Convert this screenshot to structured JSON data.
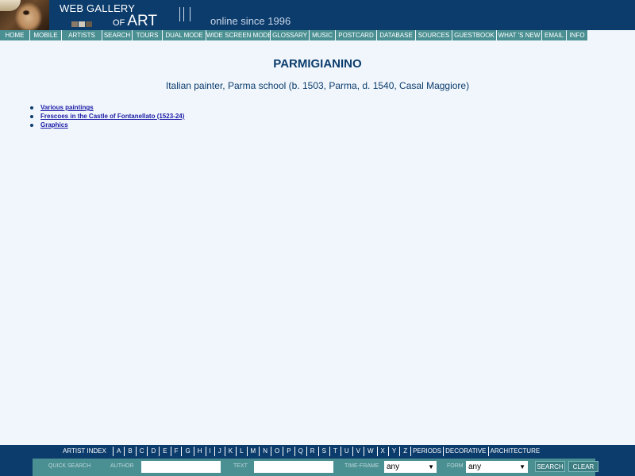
{
  "header": {
    "logo_line1": "WEB GALLERY",
    "logo_of": "OF",
    "logo_art": "ART",
    "tagline": "online since 1996",
    "logo_square_colors": [
      "#8a7a66",
      "#d0c8b8",
      "#6a5a48",
      "#a09888"
    ]
  },
  "nav": {
    "items": [
      {
        "label": "HOME"
      },
      {
        "label": "MOBILE"
      },
      {
        "label": "ARTISTS"
      },
      {
        "label": "SEARCH"
      },
      {
        "label": "TOURS"
      },
      {
        "label": "DUAL MODE"
      },
      {
        "label": "WIDE SCREEN MODES"
      },
      {
        "label": "GLOSSARY"
      },
      {
        "label": "MUSIC"
      },
      {
        "label": "POSTCARD"
      },
      {
        "label": "DATABASE"
      },
      {
        "label": "SOURCES"
      },
      {
        "label": "GUESTBOOK"
      },
      {
        "label": "WHAT 'S NEW"
      },
      {
        "label": "EMAIL"
      },
      {
        "label": "INFO"
      }
    ]
  },
  "content": {
    "title": "PARMIGIANINO",
    "subtitle": "Italian painter, Parma school (b. 1503, Parma, d. 1540, Casal Maggiore)",
    "links": [
      {
        "label": "Various paintings"
      },
      {
        "label": "Frescoes in the Castle of Fontanellato (1523-24)"
      },
      {
        "label": "Graphics"
      }
    ]
  },
  "footer": {
    "artist_index_label": "ARTIST INDEX",
    "letters": [
      "A",
      "B",
      "C",
      "D",
      "E",
      "F",
      "G",
      "H",
      "I",
      "J",
      "K",
      "L",
      "M",
      "N",
      "O",
      "P",
      "Q",
      "R",
      "S",
      "T",
      "U",
      "V",
      "W",
      "X",
      "Y",
      "Z"
    ],
    "extra_links": [
      "PERIODS",
      "DECORATIVE",
      "ARCHITECTURE"
    ],
    "search": {
      "quick_search_label": "QUICK SEARCH",
      "author_label": "AUTHOR",
      "author_value": "",
      "text_label": "TEXT",
      "text_value": "",
      "timeframe_label": "TIME-FRAME",
      "timeframe_value": "any",
      "form_label": "FORM",
      "form_value": "any",
      "search_button": "SEARCH",
      "clear_button": "CLEAR"
    }
  },
  "colors": {
    "header_bg": "#0c3c6c",
    "nav_bg": "#4a8f92",
    "page_bg": "#f0f6fc",
    "link": "#1a1aa6"
  }
}
